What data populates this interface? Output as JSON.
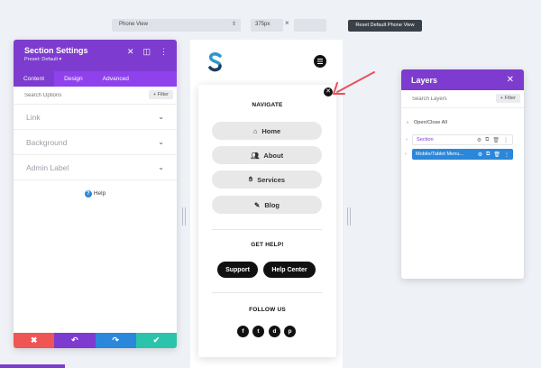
{
  "toolbar": {
    "view_select": "Phone View",
    "width_value": "375px",
    "times": "×",
    "reset_label": "Reset Default Phone View"
  },
  "settings": {
    "title": "Section Settings",
    "preset": "Preset: Default ▾",
    "tabs": [
      "Content",
      "Design",
      "Advanced"
    ],
    "search_placeholder": "Search Options",
    "filter_label": "+ Filter",
    "groups": [
      "Link",
      "Background",
      "Admin Label"
    ],
    "help_label": "Help",
    "actions": {
      "cancel": "✖",
      "undo": "↶",
      "redo": "↷",
      "save": "✔"
    }
  },
  "preview": {
    "navigate_heading": "NAVIGATE",
    "nav_items": [
      {
        "label": "Home",
        "icon": "home-icon"
      },
      {
        "label": "About",
        "icon": "users-icon"
      },
      {
        "label": "Services",
        "icon": "handshake-icon"
      },
      {
        "label": "Blog",
        "icon": "pencil-icon"
      }
    ],
    "help_heading": "GET HELP!",
    "support_label": "Support",
    "help_center_label": "Help Center",
    "follow_heading": "FOLLOW US",
    "social": [
      "f",
      "t",
      "d",
      "p"
    ]
  },
  "layers": {
    "title": "Layers",
    "search_placeholder": "Search Layers",
    "filter_label": "+ Filter",
    "open_close": "Open/Close All",
    "section_label": "Section",
    "module_label": "Mobile/Tablet Menu..."
  },
  "colors": {
    "purple": "#7e3bd0",
    "purple_light": "#8f42ec",
    "blue": "#2b87da",
    "red": "#ef5555",
    "teal": "#29c4a9",
    "arrow": "#e8505b"
  }
}
